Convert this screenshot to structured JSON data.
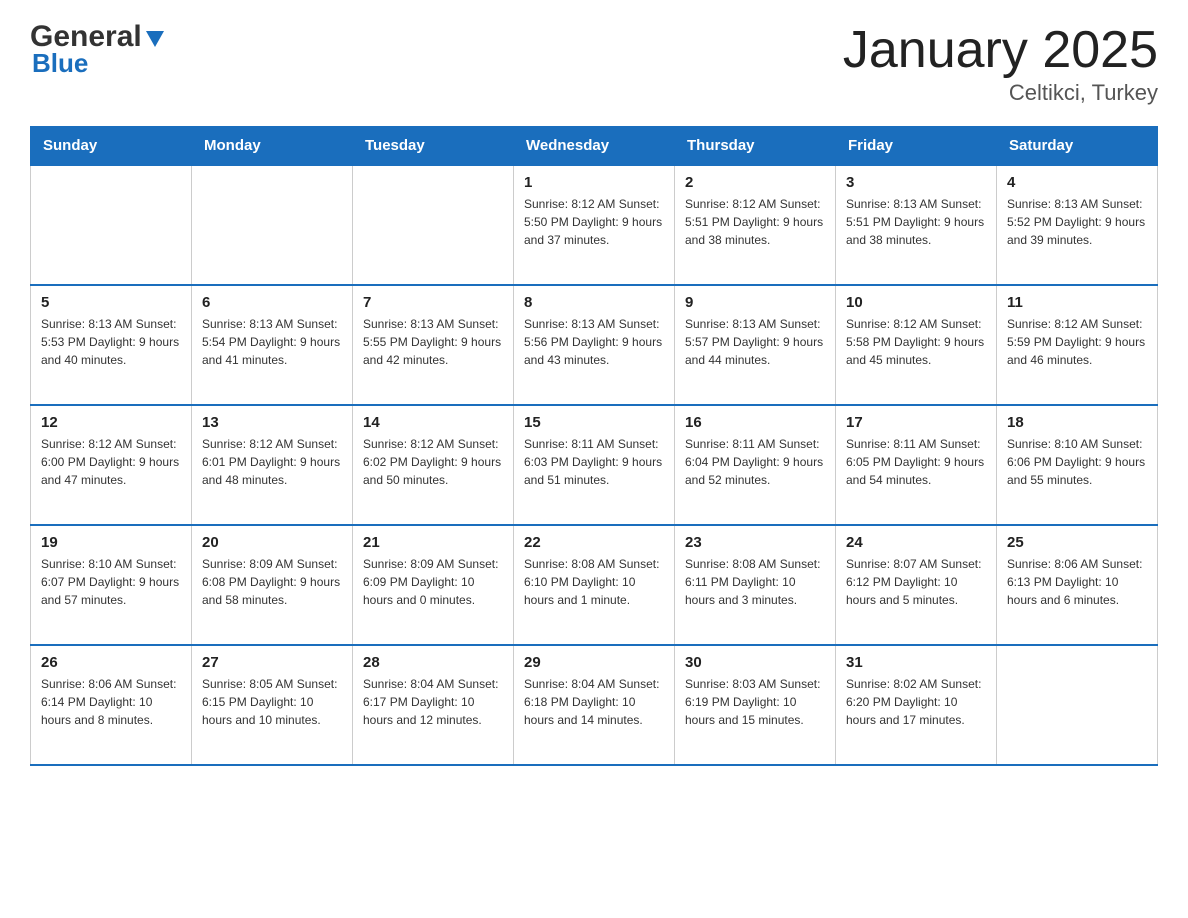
{
  "logo": {
    "general": "General",
    "triangle": "▼",
    "blue": "Blue"
  },
  "title": "January 2025",
  "subtitle": "Celtikci, Turkey",
  "days": [
    "Sunday",
    "Monday",
    "Tuesday",
    "Wednesday",
    "Thursday",
    "Friday",
    "Saturday"
  ],
  "weeks": [
    [
      {
        "num": "",
        "info": ""
      },
      {
        "num": "",
        "info": ""
      },
      {
        "num": "",
        "info": ""
      },
      {
        "num": "1",
        "info": "Sunrise: 8:12 AM\nSunset: 5:50 PM\nDaylight: 9 hours and 37 minutes."
      },
      {
        "num": "2",
        "info": "Sunrise: 8:12 AM\nSunset: 5:51 PM\nDaylight: 9 hours and 38 minutes."
      },
      {
        "num": "3",
        "info": "Sunrise: 8:13 AM\nSunset: 5:51 PM\nDaylight: 9 hours and 38 minutes."
      },
      {
        "num": "4",
        "info": "Sunrise: 8:13 AM\nSunset: 5:52 PM\nDaylight: 9 hours and 39 minutes."
      }
    ],
    [
      {
        "num": "5",
        "info": "Sunrise: 8:13 AM\nSunset: 5:53 PM\nDaylight: 9 hours and 40 minutes."
      },
      {
        "num": "6",
        "info": "Sunrise: 8:13 AM\nSunset: 5:54 PM\nDaylight: 9 hours and 41 minutes."
      },
      {
        "num": "7",
        "info": "Sunrise: 8:13 AM\nSunset: 5:55 PM\nDaylight: 9 hours and 42 minutes."
      },
      {
        "num": "8",
        "info": "Sunrise: 8:13 AM\nSunset: 5:56 PM\nDaylight: 9 hours and 43 minutes."
      },
      {
        "num": "9",
        "info": "Sunrise: 8:13 AM\nSunset: 5:57 PM\nDaylight: 9 hours and 44 minutes."
      },
      {
        "num": "10",
        "info": "Sunrise: 8:12 AM\nSunset: 5:58 PM\nDaylight: 9 hours and 45 minutes."
      },
      {
        "num": "11",
        "info": "Sunrise: 8:12 AM\nSunset: 5:59 PM\nDaylight: 9 hours and 46 minutes."
      }
    ],
    [
      {
        "num": "12",
        "info": "Sunrise: 8:12 AM\nSunset: 6:00 PM\nDaylight: 9 hours and 47 minutes."
      },
      {
        "num": "13",
        "info": "Sunrise: 8:12 AM\nSunset: 6:01 PM\nDaylight: 9 hours and 48 minutes."
      },
      {
        "num": "14",
        "info": "Sunrise: 8:12 AM\nSunset: 6:02 PM\nDaylight: 9 hours and 50 minutes."
      },
      {
        "num": "15",
        "info": "Sunrise: 8:11 AM\nSunset: 6:03 PM\nDaylight: 9 hours and 51 minutes."
      },
      {
        "num": "16",
        "info": "Sunrise: 8:11 AM\nSunset: 6:04 PM\nDaylight: 9 hours and 52 minutes."
      },
      {
        "num": "17",
        "info": "Sunrise: 8:11 AM\nSunset: 6:05 PM\nDaylight: 9 hours and 54 minutes."
      },
      {
        "num": "18",
        "info": "Sunrise: 8:10 AM\nSunset: 6:06 PM\nDaylight: 9 hours and 55 minutes."
      }
    ],
    [
      {
        "num": "19",
        "info": "Sunrise: 8:10 AM\nSunset: 6:07 PM\nDaylight: 9 hours and 57 minutes."
      },
      {
        "num": "20",
        "info": "Sunrise: 8:09 AM\nSunset: 6:08 PM\nDaylight: 9 hours and 58 minutes."
      },
      {
        "num": "21",
        "info": "Sunrise: 8:09 AM\nSunset: 6:09 PM\nDaylight: 10 hours and 0 minutes."
      },
      {
        "num": "22",
        "info": "Sunrise: 8:08 AM\nSunset: 6:10 PM\nDaylight: 10 hours and 1 minute."
      },
      {
        "num": "23",
        "info": "Sunrise: 8:08 AM\nSunset: 6:11 PM\nDaylight: 10 hours and 3 minutes."
      },
      {
        "num": "24",
        "info": "Sunrise: 8:07 AM\nSunset: 6:12 PM\nDaylight: 10 hours and 5 minutes."
      },
      {
        "num": "25",
        "info": "Sunrise: 8:06 AM\nSunset: 6:13 PM\nDaylight: 10 hours and 6 minutes."
      }
    ],
    [
      {
        "num": "26",
        "info": "Sunrise: 8:06 AM\nSunset: 6:14 PM\nDaylight: 10 hours and 8 minutes."
      },
      {
        "num": "27",
        "info": "Sunrise: 8:05 AM\nSunset: 6:15 PM\nDaylight: 10 hours and 10 minutes."
      },
      {
        "num": "28",
        "info": "Sunrise: 8:04 AM\nSunset: 6:17 PM\nDaylight: 10 hours and 12 minutes."
      },
      {
        "num": "29",
        "info": "Sunrise: 8:04 AM\nSunset: 6:18 PM\nDaylight: 10 hours and 14 minutes."
      },
      {
        "num": "30",
        "info": "Sunrise: 8:03 AM\nSunset: 6:19 PM\nDaylight: 10 hours and 15 minutes."
      },
      {
        "num": "31",
        "info": "Sunrise: 8:02 AM\nSunset: 6:20 PM\nDaylight: 10 hours and 17 minutes."
      },
      {
        "num": "",
        "info": ""
      }
    ]
  ]
}
